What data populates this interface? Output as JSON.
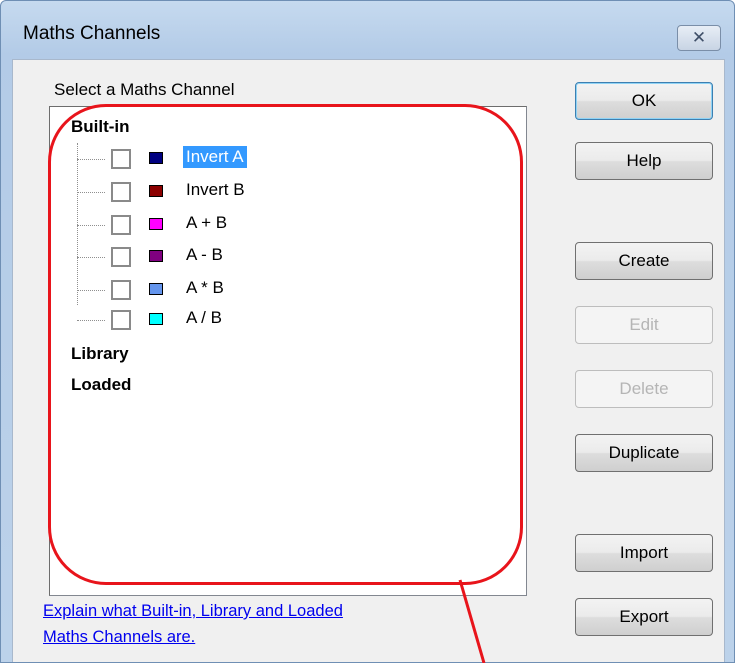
{
  "window": {
    "title": "Maths Channels",
    "close_glyph": "✕"
  },
  "main": {
    "select_label": "Select a Maths Channel",
    "tree": {
      "groups": [
        {
          "label": "Built-in",
          "items": [
            {
              "label": "Invert A",
              "color": "#000080",
              "checked": false,
              "selected": true
            },
            {
              "label": "Invert B",
              "color": "#8b0000",
              "checked": false,
              "selected": false
            },
            {
              "label": "A + B",
              "color": "#ff00ff",
              "checked": false,
              "selected": false
            },
            {
              "label": "A - B",
              "color": "#800080",
              "checked": false,
              "selected": false
            },
            {
              "label": "A * B",
              "color": "#6495ed",
              "checked": false,
              "selected": false
            },
            {
              "label": "A / B",
              "color": "#00ffff",
              "checked": false,
              "selected": false
            }
          ]
        },
        {
          "label": "Library",
          "items": []
        },
        {
          "label": "Loaded",
          "items": []
        }
      ]
    },
    "help_link_line1": "Explain what Built-in, Library and Loaded",
    "help_link_line2": "Maths Channels are."
  },
  "buttons": {
    "ok": "OK",
    "help": "Help",
    "create": "Create",
    "edit": "Edit",
    "delete": "Delete",
    "duplicate": "Duplicate",
    "import": "Import",
    "export": "Export"
  },
  "annotation_color": "#e8141b"
}
